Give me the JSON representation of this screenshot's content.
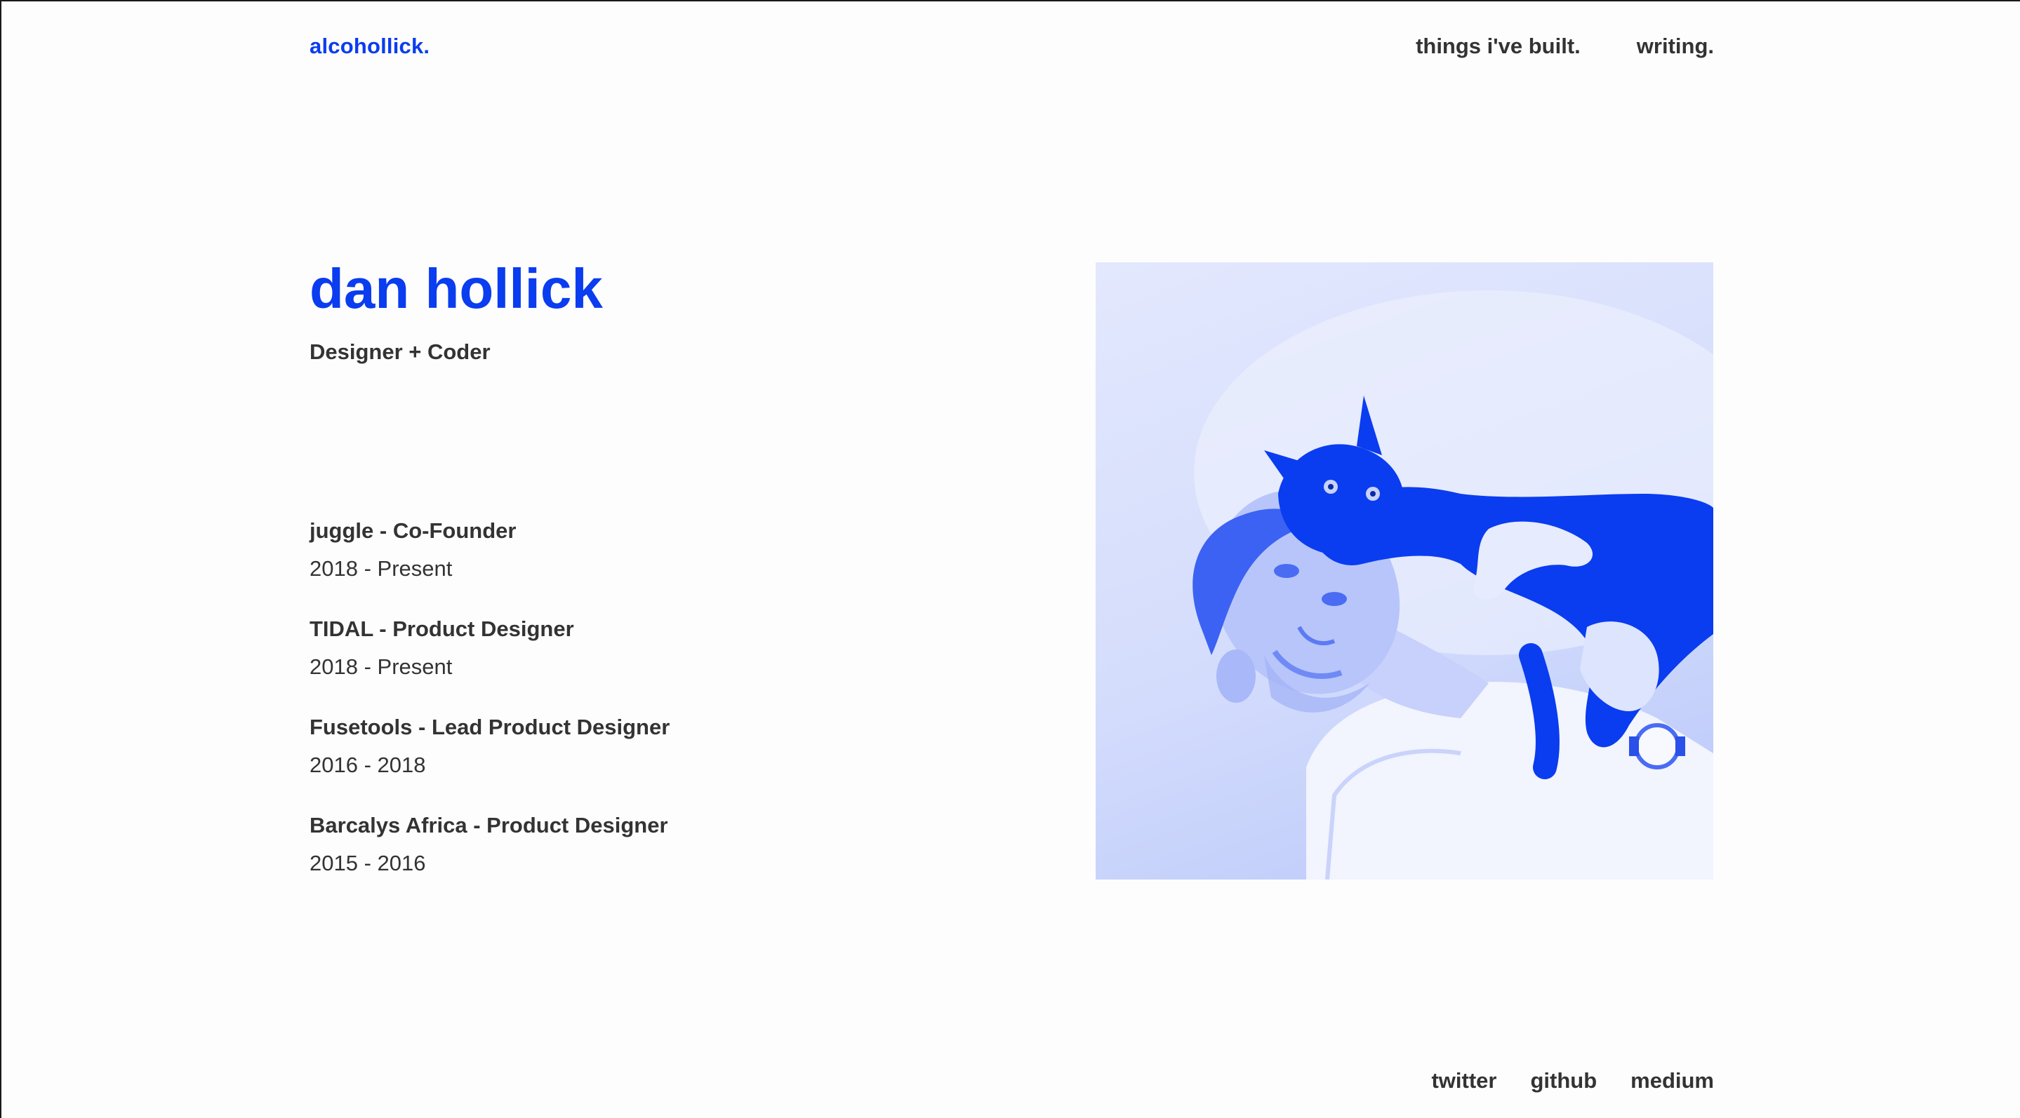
{
  "header": {
    "brand": "alcohollick.",
    "nav": [
      {
        "label": "things i've built."
      },
      {
        "label": "writing."
      }
    ]
  },
  "hero": {
    "name": "dan hollick",
    "subtitle": "Designer + Coder"
  },
  "experience": [
    {
      "title": "juggle - Co-Founder",
      "dates": "2018 - Present"
    },
    {
      "title": "TIDAL - Product Designer",
      "dates": "2018 - Present"
    },
    {
      "title": "Fusetools - Lead Product Designer",
      "dates": "2016 - 2018"
    },
    {
      "title": "Barcalys Africa - Product Designer",
      "dates": "2015 - 2016"
    }
  ],
  "photo": {
    "subject": "portrait-with-cat",
    "tint": "#0a3cf0"
  },
  "footer": {
    "links": [
      {
        "label": "twitter"
      },
      {
        "label": "github"
      },
      {
        "label": "medium"
      }
    ]
  },
  "colors": {
    "accent": "#0a3cf0",
    "text": "#333333",
    "background": "#fdfdfd"
  }
}
